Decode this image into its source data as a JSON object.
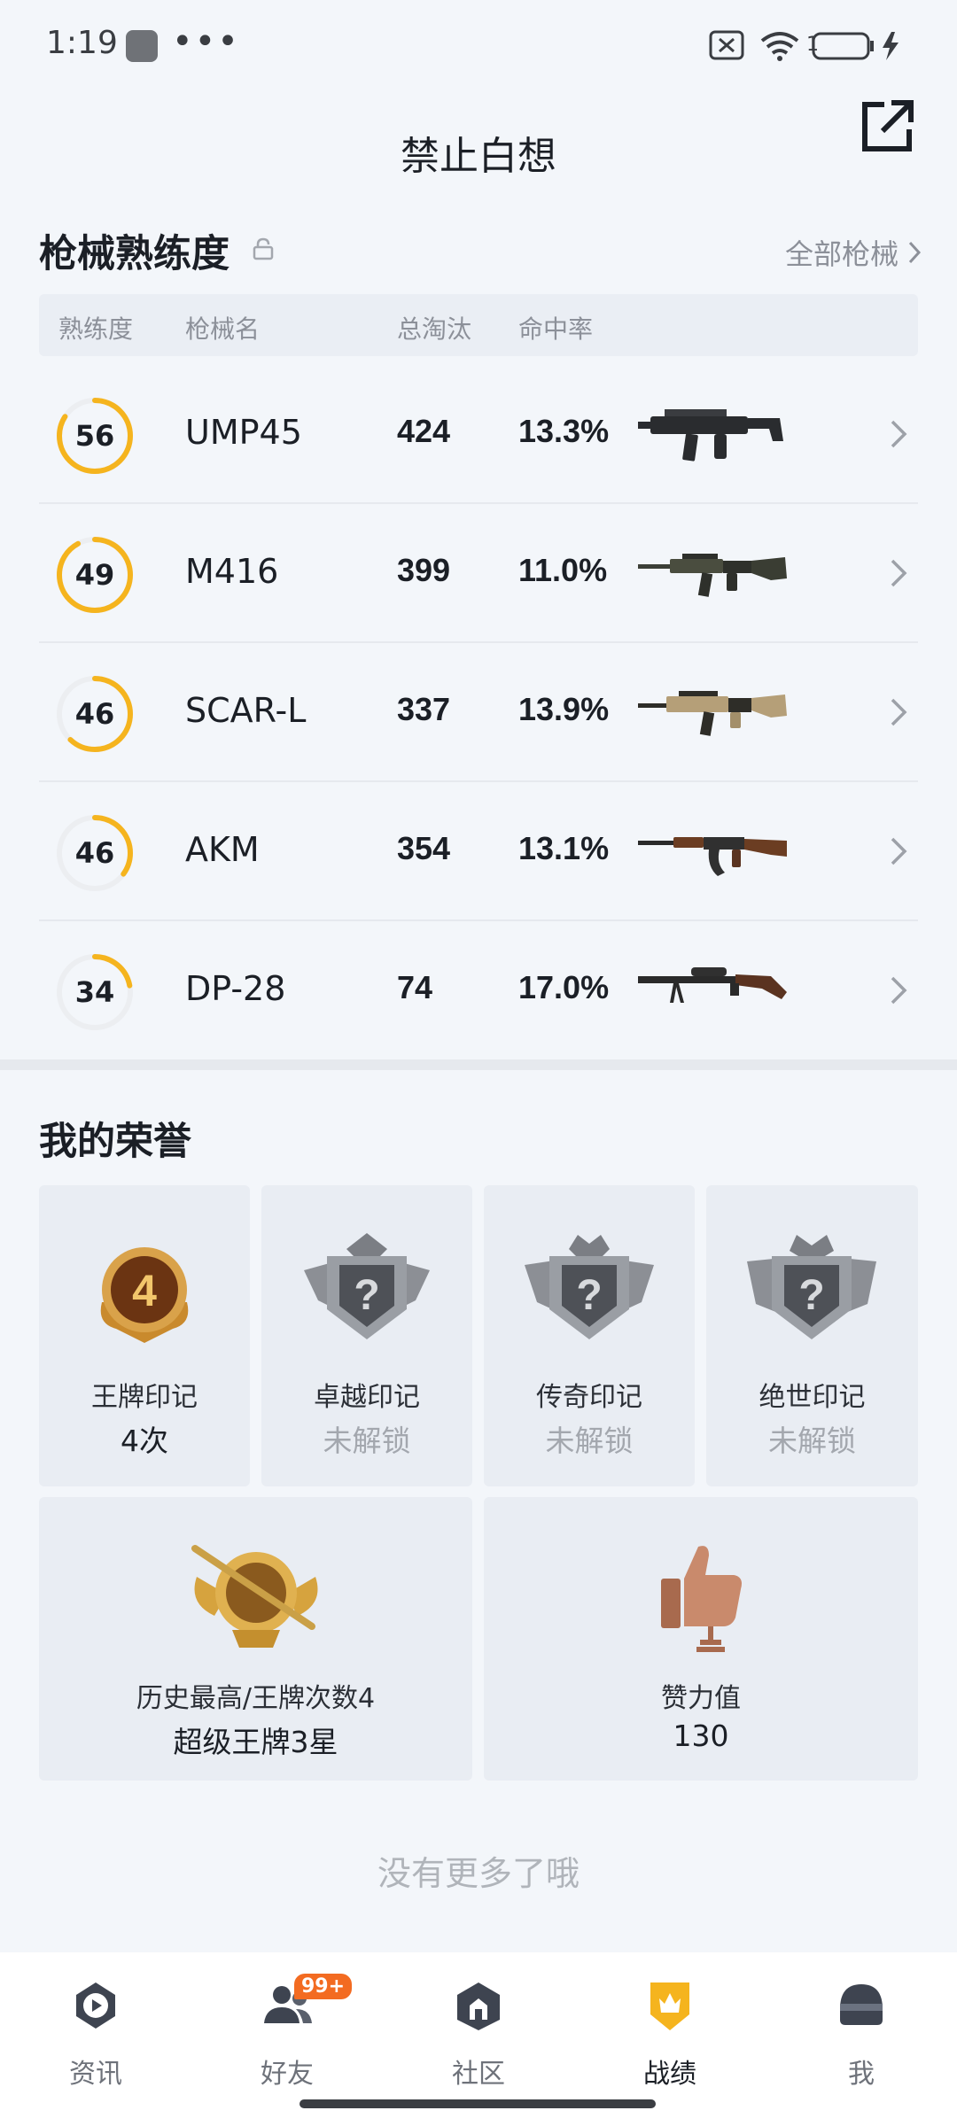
{
  "status_bar": {
    "time": "1:19",
    "dots": "•••",
    "battery": "1"
  },
  "header": {
    "title": "禁止白想"
  },
  "weapons": {
    "title": "枪械熟练度",
    "all_link": "全部枪械",
    "columns": [
      "熟练度",
      "枪械名",
      "总淘汰",
      "命中率"
    ],
    "rows": [
      {
        "mastery": "56",
        "mastery_fraction": 0.84,
        "name": "UMP45",
        "kills": "424",
        "accuracy": "13.3%",
        "gun_icon": "ump45-icon"
      },
      {
        "mastery": "49",
        "mastery_fraction": 0.92,
        "name": "M416",
        "kills": "399",
        "accuracy": "11.0%",
        "gun_icon": "m416-icon"
      },
      {
        "mastery": "46",
        "mastery_fraction": 0.62,
        "name": "SCAR-L",
        "kills": "337",
        "accuracy": "13.9%",
        "gun_icon": "scar-l-icon"
      },
      {
        "mastery": "46",
        "mastery_fraction": 0.35,
        "name": "AKM",
        "kills": "354",
        "accuracy": "13.1%",
        "gun_icon": "akm-icon"
      },
      {
        "mastery": "34",
        "mastery_fraction": 0.22,
        "name": "DP-28",
        "kills": "74",
        "accuracy": "17.0%",
        "gun_icon": "dp-28-icon"
      }
    ]
  },
  "honors": {
    "title": "我的荣誉",
    "cards": [
      {
        "label": "王牌印记",
        "value": "4次",
        "locked": false,
        "badge_number": "4"
      },
      {
        "label": "卓越印记",
        "value": "未解锁",
        "locked": true
      },
      {
        "label": "传奇印记",
        "value": "未解锁",
        "locked": true
      },
      {
        "label": "绝世印记",
        "value": "未解锁",
        "locked": true
      }
    ],
    "wide_cards": [
      {
        "label": "历史最高/王牌次数4",
        "value": "超级王牌3星"
      },
      {
        "label": "赞力值",
        "value": "130"
      }
    ]
  },
  "footer_text": "没有更多了哦",
  "nav": {
    "items": [
      {
        "label": "资讯",
        "icon": "news-icon",
        "active": false
      },
      {
        "label": "好友",
        "icon": "friends-icon",
        "active": false,
        "badge": "99+"
      },
      {
        "label": "社区",
        "icon": "community-icon",
        "active": false
      },
      {
        "label": "战绩",
        "icon": "record-icon",
        "active": true
      },
      {
        "label": "我",
        "icon": "profile-icon",
        "active": false
      }
    ]
  },
  "colors": {
    "accent": "#f5b41e",
    "ring_track": "#eceef1",
    "badge": "#f36b21"
  }
}
